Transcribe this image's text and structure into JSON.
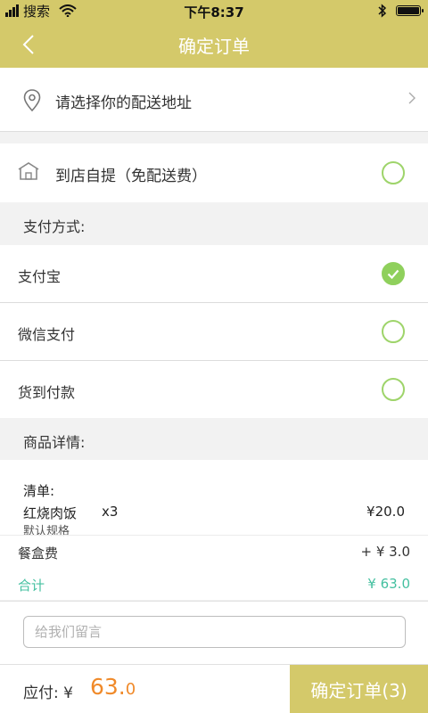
{
  "status_bar": {
    "carrier": "搜索",
    "time": "下午8:37"
  },
  "nav": {
    "title": "确定订单"
  },
  "address": {
    "prompt": "请选择你的配送地址"
  },
  "pickup": {
    "label": "到店自提（免配送费）",
    "selected": false
  },
  "payment": {
    "section_label": "支付方式:",
    "options": [
      {
        "label": "支付宝",
        "selected": true
      },
      {
        "label": "微信支付",
        "selected": false
      },
      {
        "label": "货到付款",
        "selected": false
      }
    ]
  },
  "goods": {
    "section_label": "商品详情:",
    "list_label": "清单:",
    "items": [
      {
        "name": "红烧肉饭",
        "qty": "x3",
        "price": "¥20.0",
        "spec": "默认规格"
      }
    ],
    "box_fee_label": "餐盒费",
    "box_fee_value": "+ ¥ 3.0",
    "total_label": "合计",
    "total_value": "¥ 63.0"
  },
  "message": {
    "placeholder": "给我们留言"
  },
  "footer": {
    "pay_label": "应付: ¥",
    "amount_int": "63.",
    "amount_dec": "0",
    "confirm_label": "确定订单(3)"
  },
  "colors": {
    "theme": "#d4c96a",
    "check": "#8fd05c",
    "total": "#45c0a0",
    "amount": "#f08a2a"
  }
}
